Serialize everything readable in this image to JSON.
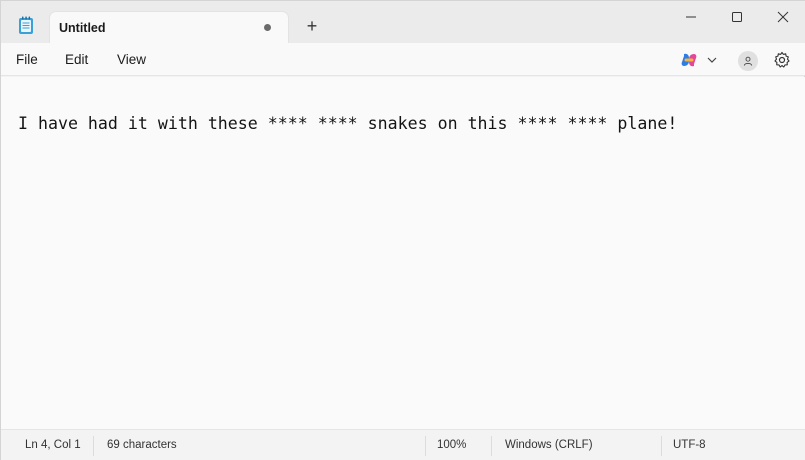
{
  "tab": {
    "title": "Untitled",
    "new_tab_label": "+"
  },
  "menu": {
    "file": "File",
    "edit": "Edit",
    "view": "View"
  },
  "editor": {
    "text": "I have had it with these **** **** snakes on this **** **** plane!"
  },
  "status": {
    "position": "Ln 4, Col 1",
    "characters": "69 characters",
    "zoom": "100%",
    "line_ending": "Windows (CRLF)",
    "encoding": "UTF-8"
  },
  "icons": {
    "app": "notepad-icon",
    "copilot": "copilot-icon",
    "account": "account-icon",
    "settings": "gear-icon"
  }
}
